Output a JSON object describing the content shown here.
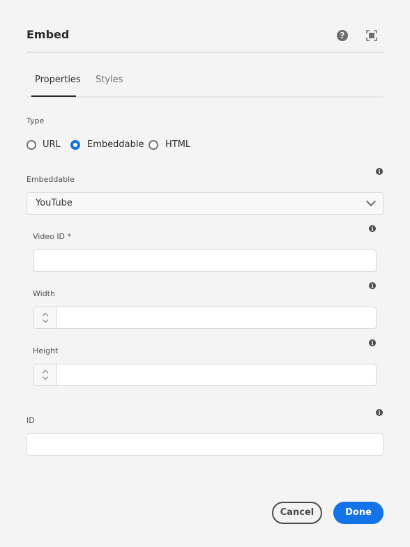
{
  "dialog": {
    "title": "Embed",
    "help_icon": "help-icon",
    "fullscreen_icon": "fullscreen-icon"
  },
  "tabs": [
    {
      "label": "Properties",
      "active": true
    },
    {
      "label": "Styles",
      "active": false
    }
  ],
  "type": {
    "label": "Type",
    "options": [
      {
        "label": "URL",
        "selected": false
      },
      {
        "label": "Embeddable",
        "selected": true
      },
      {
        "label": "HTML",
        "selected": false
      }
    ]
  },
  "embeddable": {
    "label": "Embeddable",
    "value": "YouTube",
    "info_icon": "info-icon"
  },
  "video_id": {
    "label": "Video ID *",
    "value": "",
    "placeholder": ""
  },
  "width": {
    "label": "Width",
    "value": ""
  },
  "height": {
    "label": "Height",
    "value": ""
  },
  "id": {
    "label": "ID",
    "value": ""
  },
  "footer": {
    "cancel_label": "Cancel",
    "done_label": "Done"
  },
  "colors": {
    "accent": "#1473e6",
    "background": "#f4f4f4"
  }
}
